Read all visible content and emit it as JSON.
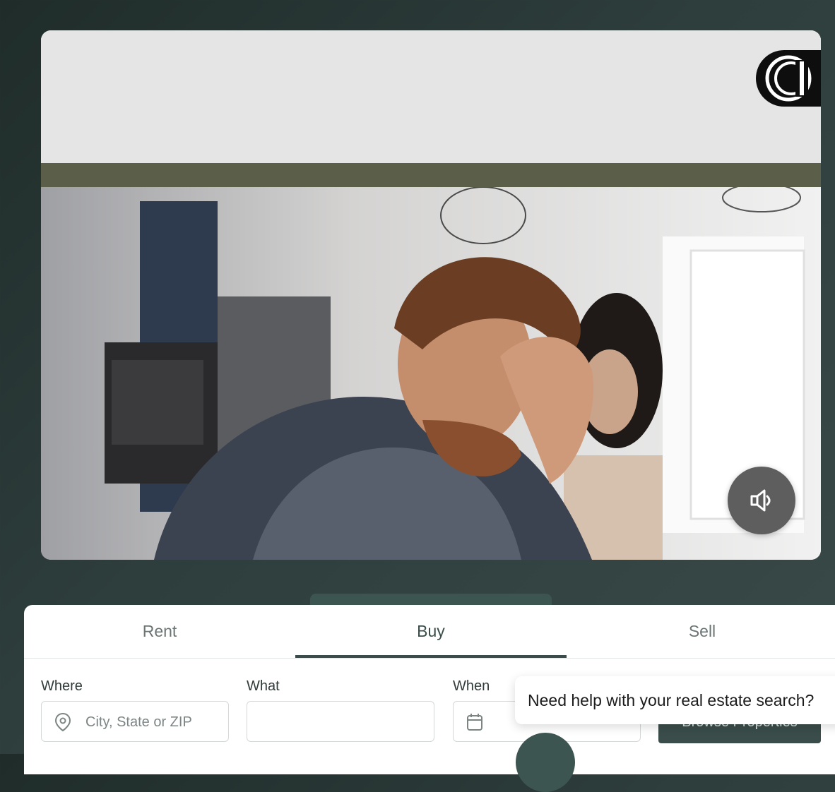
{
  "video": {
    "sound_icon": "speaker-muted-icon",
    "logo_icon": "brand-logo-icon"
  },
  "search": {
    "tabs": [
      "Rent",
      "Buy",
      "Sell"
    ],
    "active_tab": "Buy",
    "where": {
      "label": "Where",
      "placeholder": "City, State or ZIP",
      "icon": "location-pin-icon"
    },
    "what": {
      "label": "What",
      "value": ""
    },
    "when": {
      "label": "When",
      "icon": "calendar-icon"
    },
    "browse_label": "Browse Properties"
  },
  "help": {
    "text": "Need help with your real estate search?"
  },
  "colors": {
    "accent": "#3a4d4a",
    "band": "#5b5f4a",
    "background": "#243231"
  }
}
